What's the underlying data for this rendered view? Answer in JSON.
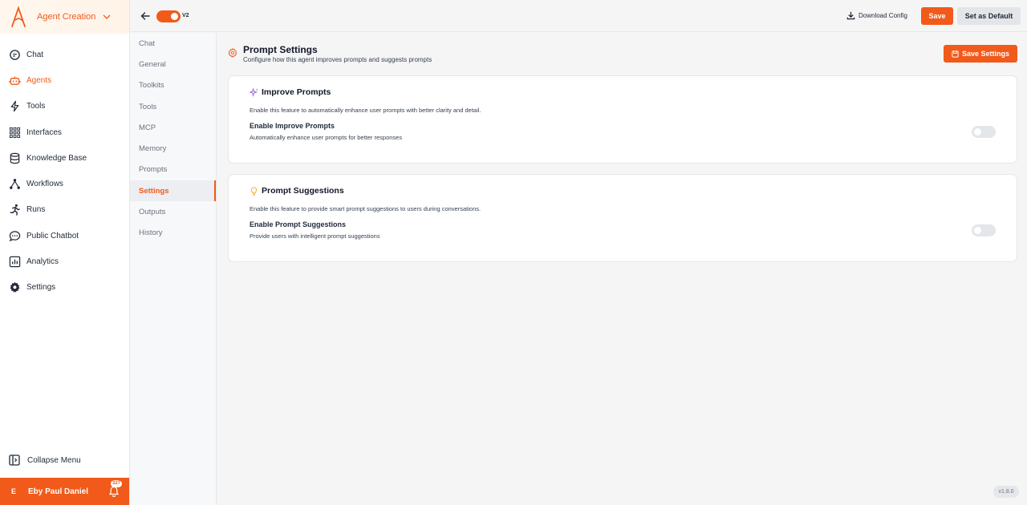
{
  "app": {
    "workspace_label": "Agent Creation"
  },
  "sidebar": {
    "items": [
      {
        "label": "Chat",
        "icon": "chat-bubble-icon",
        "active": false
      },
      {
        "label": "Agents",
        "icon": "robot-icon",
        "active": true
      },
      {
        "label": "Tools",
        "icon": "lightning-icon",
        "active": false
      },
      {
        "label": "Interfaces",
        "icon": "grid-dots-icon",
        "active": false
      },
      {
        "label": "Knowledge Base",
        "icon": "database-icon",
        "active": false
      },
      {
        "label": "Workflows",
        "icon": "workflow-icon",
        "active": false
      },
      {
        "label": "Runs",
        "icon": "running-person-icon",
        "active": false
      },
      {
        "label": "Public Chatbot",
        "icon": "chat-dots-icon",
        "active": false
      },
      {
        "label": "Analytics",
        "icon": "bar-chart-icon",
        "active": false
      },
      {
        "label": "Settings",
        "icon": "gear-icon",
        "active": false
      }
    ],
    "collapse_label": "Collapse Menu",
    "user": {
      "initial": "E",
      "name": "Eby Paul Daniel",
      "notification_count": "327"
    }
  },
  "topbar": {
    "version_label": "V2",
    "version_toggle_on": true,
    "download_config_label": "Download Config",
    "save_label": "Save",
    "set_default_label": "Set as Default"
  },
  "subnav": {
    "items": [
      {
        "label": "Chat",
        "active": false
      },
      {
        "label": "General",
        "active": false
      },
      {
        "label": "Toolkits",
        "active": false
      },
      {
        "label": "Tools",
        "active": false
      },
      {
        "label": "MCP",
        "active": false
      },
      {
        "label": "Memory",
        "active": false
      },
      {
        "label": "Prompts",
        "active": false
      },
      {
        "label": "Settings",
        "active": true
      },
      {
        "label": "Outputs",
        "active": false
      },
      {
        "label": "History",
        "active": false
      }
    ]
  },
  "main": {
    "title": "Prompt Settings",
    "subtitle": "Configure how this agent improves prompts and suggests prompts",
    "save_settings_label": "Save Settings",
    "cards": [
      {
        "title": "Improve Prompts",
        "icon": "sparkles-icon",
        "description": "Enable this feature to automatically enhance user prompts with better clarity and detail.",
        "option_title": "Enable Improve Prompts",
        "option_description": "Automatically enhance user prompts for better responses",
        "enabled": false
      },
      {
        "title": "Prompt Suggestions",
        "icon": "lightbulb-icon",
        "description": "Enable this feature to provide smart prompt suggestions to users during conversations.",
        "option_title": "Enable Prompt Suggestions",
        "option_description": "Provide users with intelligent prompt suggestions",
        "enabled": false
      }
    ]
  },
  "footer": {
    "version": "v1.8.0"
  },
  "colors": {
    "accent": "#f15a1a",
    "sparkle": "#9b5de5",
    "bulb": "#f5a623"
  }
}
